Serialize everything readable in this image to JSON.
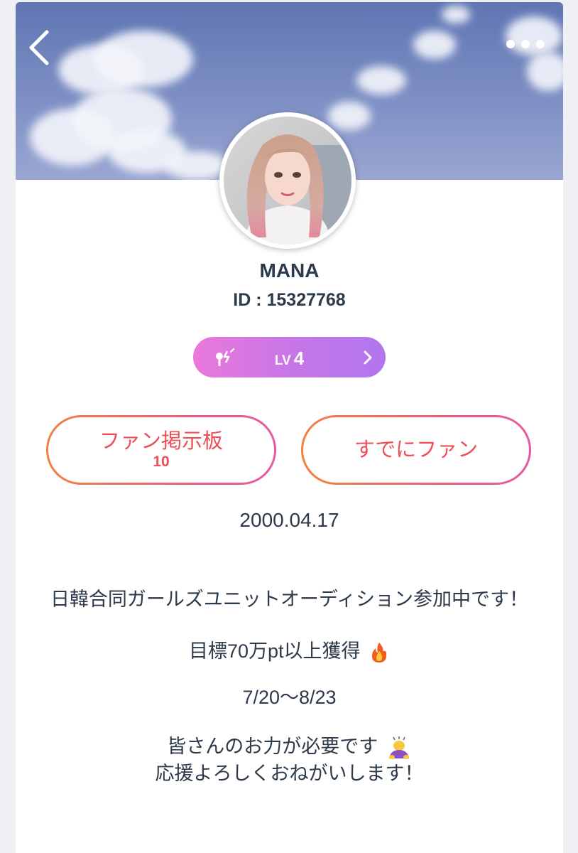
{
  "profile": {
    "name": "MANA",
    "id_text": "ID : 15327768"
  },
  "level": {
    "prefix": "LV",
    "value": "4"
  },
  "buttons": {
    "fan_board_label": "ファン掲示板",
    "fan_board_count": "10",
    "already_fan_label": "すでにファン"
  },
  "birthday": "2000.04.17",
  "bio": {
    "line1": "日韓合同ガールズユニットオーディション参加中です！",
    "line2": "目標70万pt以上獲得",
    "line3": "7/20〜8/23",
    "line4": "皆さんのお力が必要です",
    "line5": "応援よろしくおねがいします！"
  },
  "icons": {
    "back": "chevron-left-icon",
    "more": "more-dots-icon",
    "level": "level-key-icon",
    "chevron": "chevron-right-icon",
    "fire": "fire-emoji-icon",
    "bow": "bowing-person-emoji-icon"
  },
  "colors": {
    "accent_text": "#ec4f58",
    "button_gradient_start": "#f28140",
    "button_gradient_end": "#e55aa5",
    "level_gradient_start": "#ea78d9",
    "level_gradient_end": "#b276ee",
    "text_primary": "#2c3a4a"
  }
}
